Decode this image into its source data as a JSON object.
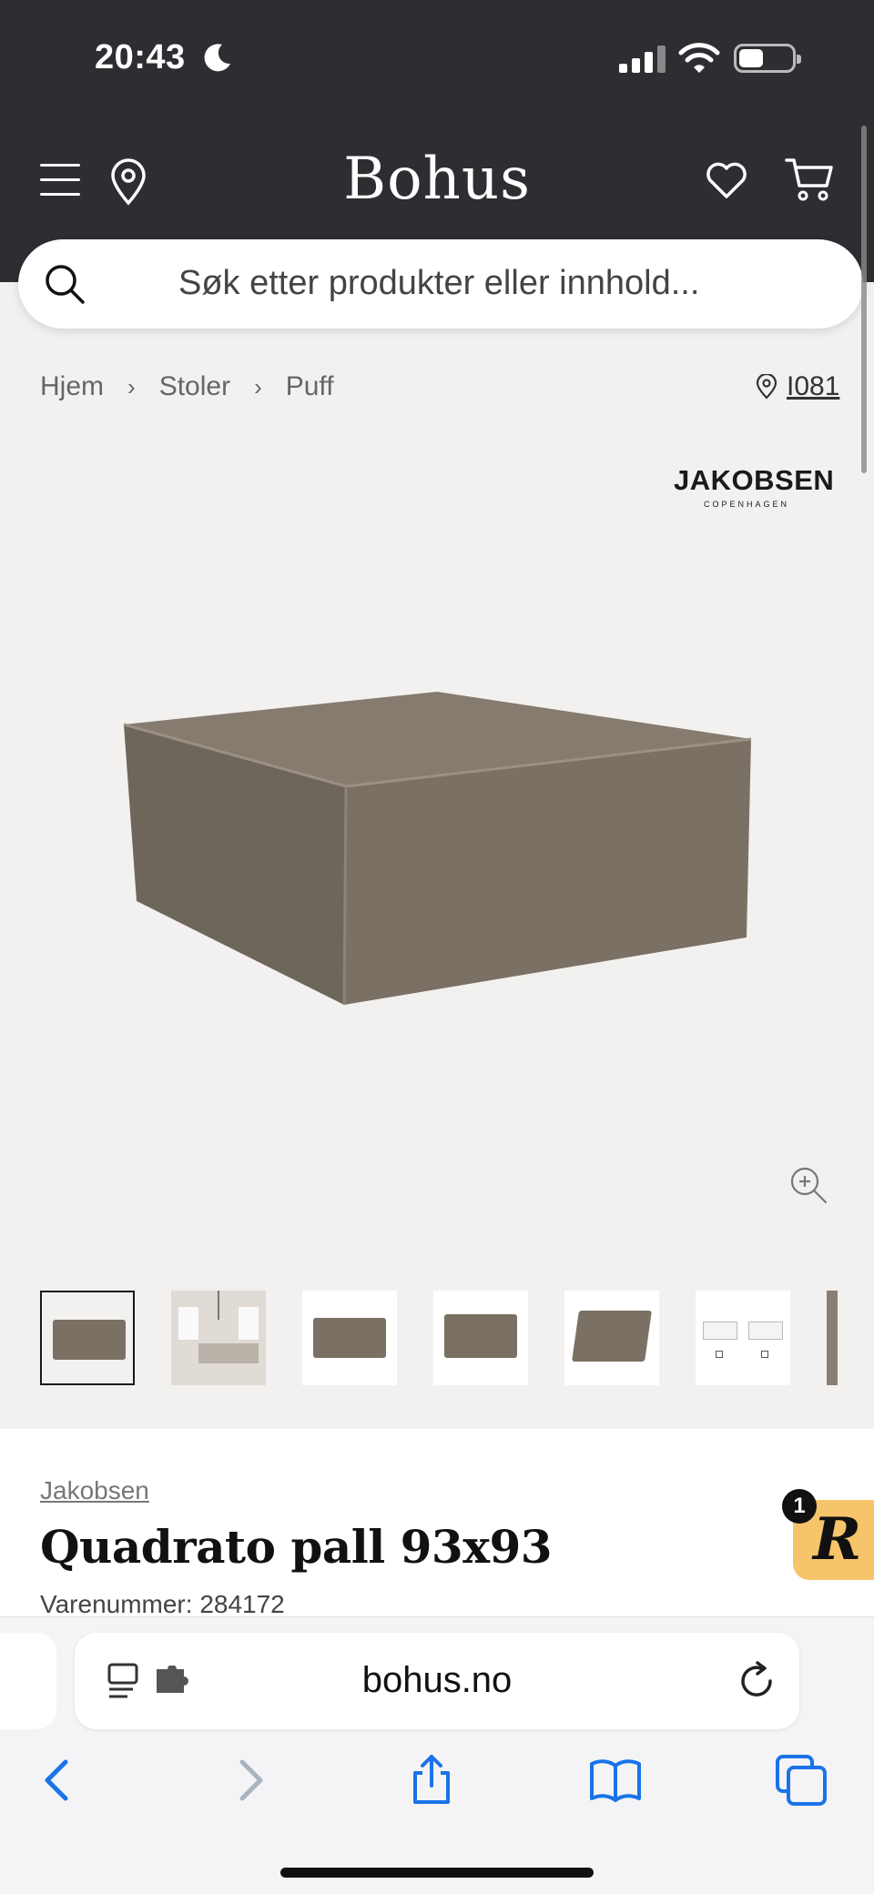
{
  "status_bar": {
    "time": "20:43"
  },
  "header": {
    "logo": "Bohus"
  },
  "search": {
    "placeholder": "Søk etter produkter eller innhold..."
  },
  "breadcrumb": {
    "items": [
      "Hjem",
      "Stoler",
      "Puff"
    ]
  },
  "store": {
    "label": "I081"
  },
  "brand_logo": {
    "name": "JAKOBSEN",
    "sub": "COPENHAGEN"
  },
  "product": {
    "brand": "Jakobsen",
    "title": "Quadrato pall 93x93",
    "sku": "Varenummer: 284172",
    "color": "#7b7064"
  },
  "badge": {
    "letter": "R",
    "count": "1"
  },
  "browser": {
    "url": "bohus.no"
  },
  "colors": {
    "header_bg": "#2e2d32",
    "accent_blue": "#1a73e8",
    "badge_bg": "#f6c46a"
  }
}
